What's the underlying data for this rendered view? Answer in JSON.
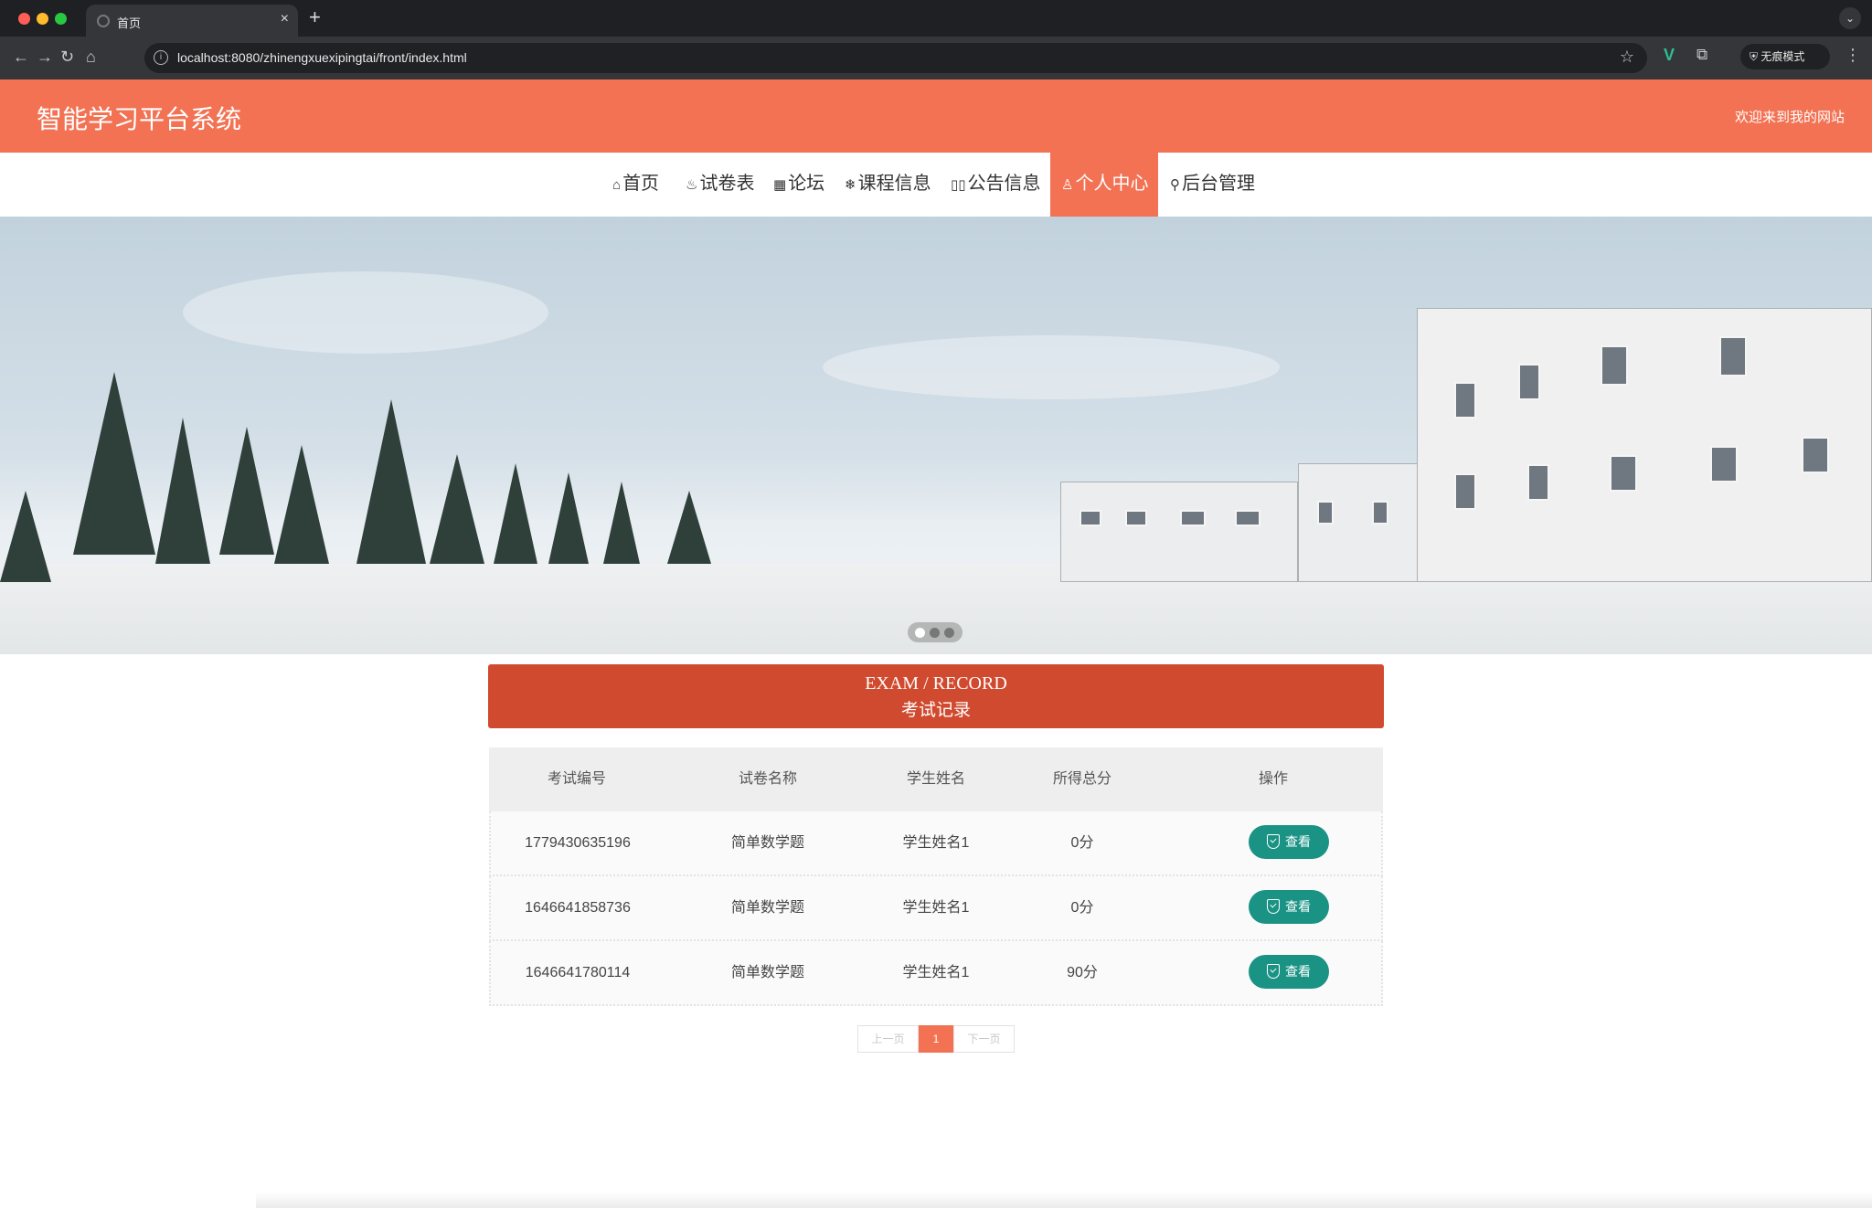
{
  "browser": {
    "tab_title": "首页",
    "url": "localhost:8080/zhinengxuexipingtai/front/index.html",
    "incognito_label": "无痕模式"
  },
  "header": {
    "site_title": "智能学习平台系统",
    "welcome": "欢迎来到我的网站"
  },
  "nav": {
    "items": [
      {
        "label": "首页",
        "icon": "home-icon",
        "glyph": "⌂"
      },
      {
        "label": "试卷表",
        "icon": "palette-icon",
        "glyph": "♨"
      },
      {
        "label": "论坛",
        "icon": "calendar-icon",
        "glyph": "▦"
      },
      {
        "label": "课程信息",
        "icon": "snowflake-icon",
        "glyph": "❄"
      },
      {
        "label": "公告信息",
        "icon": "columns-icon",
        "glyph": "▯▯"
      },
      {
        "label": "个人中心",
        "icon": "user-icon",
        "glyph": "♙"
      },
      {
        "label": "后台管理",
        "icon": "link-icon",
        "glyph": "⚲"
      }
    ],
    "active_index": 5
  },
  "section": {
    "title_en": "EXAM / RECORD",
    "title_cn": "考试记录"
  },
  "table": {
    "headers": [
      "考试编号",
      "试卷名称",
      "学生姓名",
      "所得总分",
      "操作"
    ],
    "rows": [
      {
        "id": "1779430635196",
        "paper": "简单数学题",
        "student": "学生姓名1",
        "score": "0分",
        "action": "查看"
      },
      {
        "id": "1646641858736",
        "paper": "简单数学题",
        "student": "学生姓名1",
        "score": "0分",
        "action": "查看"
      },
      {
        "id": "1646641780114",
        "paper": "简单数学题",
        "student": "学生姓名1",
        "score": "90分",
        "action": "查看"
      }
    ]
  },
  "pagination": {
    "prev": "上一页",
    "current": "1",
    "next": "下一页"
  },
  "colors": {
    "brand": "#f27253",
    "section_header": "#d04a2f",
    "action_button": "#1a9384"
  }
}
